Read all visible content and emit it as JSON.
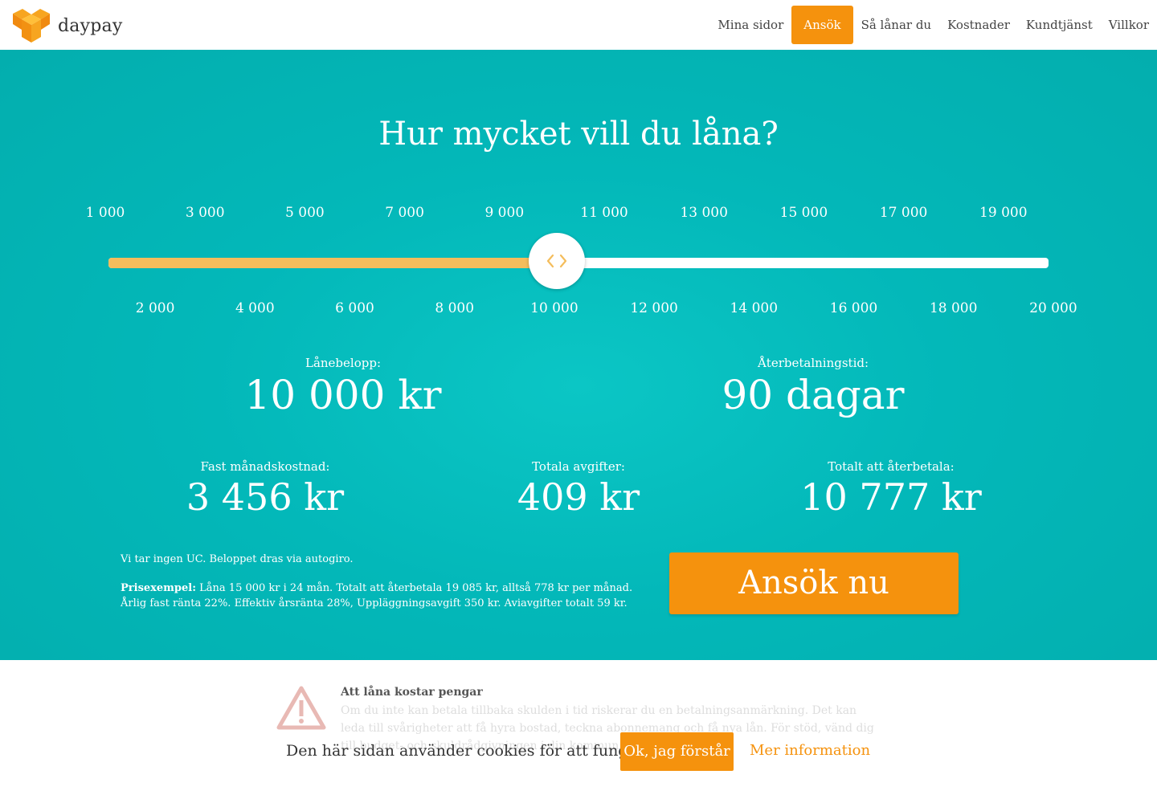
{
  "header": {
    "logo_text": "daypay",
    "nav": [
      {
        "label": "Mina sidor",
        "active": false
      },
      {
        "label": "Ansök",
        "active": true
      },
      {
        "label": "Så lånar du",
        "active": false
      },
      {
        "label": "Kostnader",
        "active": false
      },
      {
        "label": "Kundtjänst",
        "active": false
      },
      {
        "label": "Villkor",
        "active": false
      }
    ],
    "accent_color": "#f5920d"
  },
  "hero": {
    "title": "Hur mycket vill du låna?",
    "slider": {
      "ticks_top": [
        "1 000",
        "3 000",
        "5 000",
        "7 000",
        "9 000",
        "11 000",
        "13 000",
        "15 000",
        "17 000",
        "19 000"
      ],
      "ticks_bottom": [
        "2 000",
        "4 000",
        "6 000",
        "8 000",
        "10 000",
        "12 000",
        "14 000",
        "16 000",
        "18 000",
        "20 000"
      ],
      "min": 1000,
      "max": 20000,
      "value": 10000,
      "fill_color": "#f4bd5c",
      "handle_icon": "chevron-left-right-icon"
    },
    "loan_amount": {
      "label": "Lånebelopp:",
      "value": "10 000 kr"
    },
    "repayment_time": {
      "label": "Återbetalningstid:",
      "value": "90 dagar"
    },
    "monthly_cost": {
      "label": "Fast månadskostnad:",
      "value": "3 456 kr"
    },
    "total_fees": {
      "label": "Totala avgifter:",
      "value": "409 kr"
    },
    "total_repay": {
      "label": "Totalt att återbetala:",
      "value": "10 777 kr"
    },
    "note_uc": "Vi tar ingen UC. Beloppet dras via autogiro.",
    "price_example_label": "Prisexempel:",
    "price_example_text": " Låna 15 000 kr i 24 mån. Totalt att återbetala 19 085 kr, alltså 778 kr per månad. Årlig fast ränta 22%. Effektiv årsränta 28%, Uppläggningsavgift 350 kr. Aviavgifter totalt 59 kr.",
    "apply_button": "Ansök nu",
    "background_color": "#03b8b9"
  },
  "warning": {
    "icon": "warning-triangle-icon",
    "title": "Att låna kostar pengar",
    "text": "Om du inte kan betala tillbaka skulden i tid riskerar du en betalningsanmärkning. Det kan leda till svårigheter att få hyra bostad, teckna abonnemang och få nya lån. För stöd, vänd dig till budget- och skuldrådgivningen i din kommun."
  },
  "cookie_banner": {
    "text": "Den här sidan använder cookies för att fungera.",
    "ok_button": "Ok, jag förstår",
    "more_link": "Mer information"
  }
}
